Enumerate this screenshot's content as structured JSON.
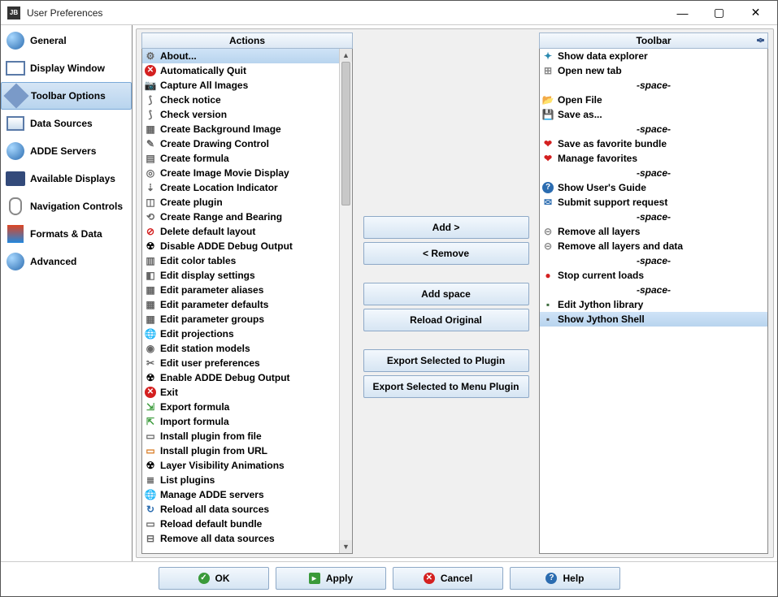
{
  "window": {
    "title": "User Preferences"
  },
  "sidebar": {
    "items": [
      {
        "label": "General",
        "icon": "globe-icon"
      },
      {
        "label": "Display Window",
        "icon": "window-icon"
      },
      {
        "label": "Toolbar Options",
        "icon": "toolbar-icon",
        "selected": true
      },
      {
        "label": "Data Sources",
        "icon": "data-sources-icon"
      },
      {
        "label": "ADDE Servers",
        "icon": "adde-icon"
      },
      {
        "label": "Available Displays",
        "icon": "displays-icon"
      },
      {
        "label": "Navigation Controls",
        "icon": "mouse-icon"
      },
      {
        "label": "Formats & Data",
        "icon": "formats-icon"
      },
      {
        "label": "Advanced",
        "icon": "advanced-icon"
      }
    ]
  },
  "columns": {
    "actions_header": "Actions",
    "toolbar_header": "Toolbar"
  },
  "actions": [
    {
      "label": "About...",
      "icon": "gear-icon",
      "selected": true
    },
    {
      "label": "Automatically Quit",
      "icon": "error-icon"
    },
    {
      "label": "Capture All Images",
      "icon": "camera-icon"
    },
    {
      "label": "Check notice",
      "icon": "antenna-icon"
    },
    {
      "label": "Check version",
      "icon": "antenna-icon"
    },
    {
      "label": "Create Background Image",
      "icon": "picture-icon"
    },
    {
      "label": "Create Drawing Control",
      "icon": "pencil-icon"
    },
    {
      "label": "Create formula",
      "icon": "calculator-icon"
    },
    {
      "label": "Create Image Movie Display",
      "icon": "film-icon"
    },
    {
      "label": "Create Location Indicator",
      "icon": "pin-icon"
    },
    {
      "label": "Create plugin",
      "icon": "plugin-icon"
    },
    {
      "label": "Create Range and Bearing",
      "icon": "range-icon"
    },
    {
      "label": "Delete default layout",
      "icon": "delete-icon"
    },
    {
      "label": "Disable ADDE Debug Output",
      "icon": "radiation-icon"
    },
    {
      "label": "Edit color tables",
      "icon": "palette-icon"
    },
    {
      "label": "Edit display settings",
      "icon": "settings-icon"
    },
    {
      "label": "Edit parameter aliases",
      "icon": "param-icon"
    },
    {
      "label": "Edit parameter defaults",
      "icon": "param-icon"
    },
    {
      "label": "Edit parameter groups",
      "icon": "param-icon"
    },
    {
      "label": "Edit projections",
      "icon": "globe-icon"
    },
    {
      "label": "Edit station models",
      "icon": "station-icon"
    },
    {
      "label": "Edit user preferences",
      "icon": "tools-icon"
    },
    {
      "label": "Enable ADDE Debug Output",
      "icon": "radiation-icon"
    },
    {
      "label": "Exit",
      "icon": "error-icon"
    },
    {
      "label": "Export formula",
      "icon": "export-icon"
    },
    {
      "label": "Import formula",
      "icon": "import-icon"
    },
    {
      "label": "Install plugin from file",
      "icon": "file-icon"
    },
    {
      "label": "Install plugin from URL",
      "icon": "url-icon"
    },
    {
      "label": "Layer Visibility Animations",
      "icon": "radiation-icon"
    },
    {
      "label": "List plugins",
      "icon": "list-icon"
    },
    {
      "label": "Manage ADDE servers",
      "icon": "globe-icon"
    },
    {
      "label": "Reload all data sources",
      "icon": "reload-icon"
    },
    {
      "label": "Reload default bundle",
      "icon": "bundle-icon"
    },
    {
      "label": "Remove all data sources",
      "icon": "remove-icon"
    }
  ],
  "toolbar": [
    {
      "label": "Show data explorer",
      "icon": "explorer-icon"
    },
    {
      "label": "Open new tab",
      "icon": "tab-icon"
    },
    {
      "label": "-space-",
      "spacer": true
    },
    {
      "label": "Open File",
      "icon": "folder-icon"
    },
    {
      "label": "Save as...",
      "icon": "save-icon"
    },
    {
      "label": "-space-",
      "spacer": true
    },
    {
      "label": "Save as favorite bundle",
      "icon": "heart-icon"
    },
    {
      "label": "Manage favorites",
      "icon": "heart-list-icon"
    },
    {
      "label": "-space-",
      "spacer": true
    },
    {
      "label": "Show User's Guide",
      "icon": "help-icon"
    },
    {
      "label": "Submit support request",
      "icon": "support-icon"
    },
    {
      "label": "-space-",
      "spacer": true
    },
    {
      "label": "Remove all layers",
      "icon": "remove-layers-icon"
    },
    {
      "label": "Remove all layers and data",
      "icon": "remove-all-icon"
    },
    {
      "label": "-space-",
      "spacer": true
    },
    {
      "label": "Stop current loads",
      "icon": "stop-icon"
    },
    {
      "label": "-space-",
      "spacer": true
    },
    {
      "label": "Edit Jython library",
      "icon": "jython-icon"
    },
    {
      "label": "Show Jython Shell",
      "icon": "shell-icon",
      "selected": true
    }
  ],
  "buttons": {
    "add": "Add  >",
    "remove": "<  Remove",
    "add_space": "Add space",
    "reload_original": "Reload Original",
    "export_plugin": "Export Selected to Plugin",
    "export_menu_plugin": "Export Selected to Menu Plugin"
  },
  "footer": {
    "ok": "OK",
    "apply": "Apply",
    "cancel": "Cancel",
    "help": "Help"
  },
  "icon_colors": {
    "error": "#d42020",
    "heart": "#d42020",
    "stop": "#d42020",
    "ok": "#3a9a3a",
    "apply": "#3a9a3a",
    "help": "#2b6cb0",
    "folder": "#d8a840",
    "save": "#4a6aa8"
  }
}
